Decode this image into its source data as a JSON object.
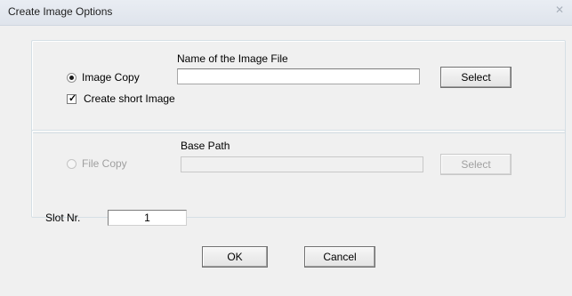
{
  "window": {
    "title": "Create Image Options",
    "close_glyph": "✕"
  },
  "image_group": {
    "heading": "Name of the Image File",
    "radio_label": "Image Copy",
    "radio_selected": true,
    "filename_value": "",
    "select_button": "Select",
    "checkbox_label": "Create short Image",
    "checkbox_checked": true
  },
  "file_group": {
    "heading": "Base Path",
    "radio_label": "File Copy",
    "radio_selected": false,
    "path_value": "",
    "select_button": "Select"
  },
  "slot": {
    "label": "Slot Nr.",
    "value": "1"
  },
  "buttons": {
    "ok": "OK",
    "cancel": "Cancel"
  }
}
